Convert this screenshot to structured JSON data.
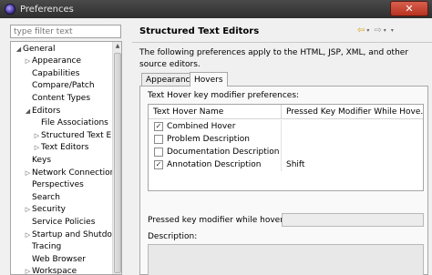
{
  "window": {
    "title": "Preferences",
    "close_label": "✕"
  },
  "sidebar": {
    "filter_placeholder": "type filter text",
    "items": [
      {
        "label": "General",
        "arrow": "◢",
        "indent": 0
      },
      {
        "label": "Appearance",
        "arrow": "▷",
        "indent": 1
      },
      {
        "label": "Capabilities",
        "arrow": "",
        "indent": 1
      },
      {
        "label": "Compare/Patch",
        "arrow": "",
        "indent": 1
      },
      {
        "label": "Content Types",
        "arrow": "",
        "indent": 1
      },
      {
        "label": "Editors",
        "arrow": "◢",
        "indent": 1
      },
      {
        "label": "File Associations",
        "arrow": "",
        "indent": 2
      },
      {
        "label": "Structured Text E",
        "arrow": "▷",
        "indent": 2
      },
      {
        "label": "Text Editors",
        "arrow": "▷",
        "indent": 2
      },
      {
        "label": "Keys",
        "arrow": "",
        "indent": 1
      },
      {
        "label": "Network Connection",
        "arrow": "▷",
        "indent": 1
      },
      {
        "label": "Perspectives",
        "arrow": "",
        "indent": 1
      },
      {
        "label": "Search",
        "arrow": "",
        "indent": 1
      },
      {
        "label": "Security",
        "arrow": "▷",
        "indent": 1
      },
      {
        "label": "Service Policies",
        "arrow": "",
        "indent": 1
      },
      {
        "label": "Startup and Shutdown",
        "arrow": "▷",
        "indent": 1
      },
      {
        "label": "Tracing",
        "arrow": "",
        "indent": 1
      },
      {
        "label": "Web Browser",
        "arrow": "",
        "indent": 1
      },
      {
        "label": "Workspace",
        "arrow": "▷",
        "indent": 1
      }
    ],
    "scroll_up": "▲"
  },
  "header": {
    "title": "Structured Text Editors",
    "back_icon": "⇦",
    "forward_icon": "⇨",
    "dropdown": "▾",
    "menu_icon": "▾"
  },
  "main": {
    "description": "The following preferences apply to the HTML, JSP, XML, and other source editors.",
    "tabs": [
      {
        "label": "Appearance",
        "active": false
      },
      {
        "label": "Hovers",
        "active": true
      }
    ],
    "hover_modifier_label": "Text Hover key modifier preferences:",
    "table": {
      "columns": [
        "Text Hover Name",
        "Pressed Key Modifier While Hove..."
      ],
      "rows": [
        {
          "name": "Combined Hover",
          "checked": true,
          "modifier": ""
        },
        {
          "name": "Problem Description",
          "checked": false,
          "modifier": ""
        },
        {
          "name": "Documentation Description",
          "checked": false,
          "modifier": ""
        },
        {
          "name": "Annotation Description",
          "checked": true,
          "modifier": "Shift"
        }
      ]
    },
    "pressed_modifier_label": "Pressed key modifier while hovering:",
    "pressed_modifier_value": "",
    "description_label": "Description:",
    "check_glyph": "✓"
  },
  "colors": {
    "titlebar": "#2e2e2e",
    "close": "#c8402e",
    "accent_icon": "#d9a21b"
  }
}
